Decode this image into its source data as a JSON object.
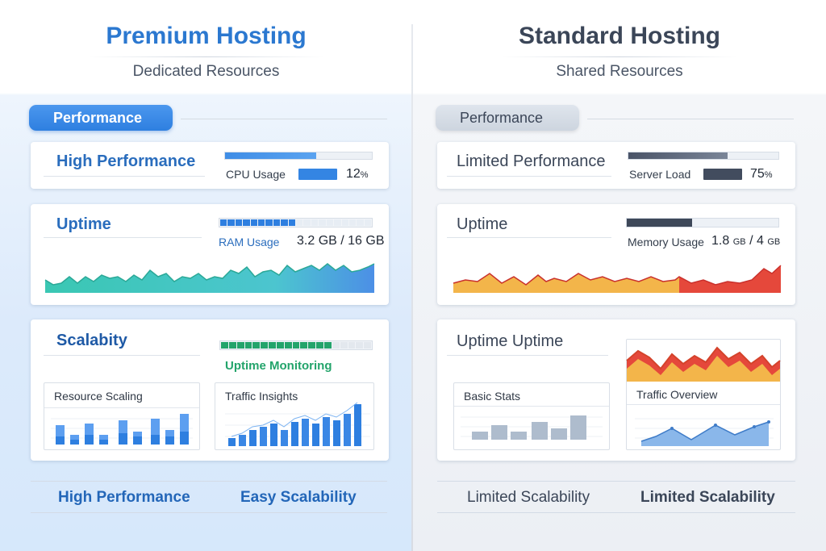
{
  "premium": {
    "title": "Premium Hosting",
    "subtitle": "Dedicated Resources",
    "pill_label": "Performance",
    "card1": {
      "title": "High Performance",
      "bar_fraction": 0.62,
      "metric_label": "CPU Usage",
      "metric_value": "12",
      "metric_unit": "%",
      "metric_fraction": 0.5
    },
    "card2": {
      "title": "Uptime",
      "segments_filled": 10,
      "segments_total": 20,
      "metric_label": "RAM Usage",
      "metric_value": "3.2 GB / 16 GB"
    },
    "card3": {
      "title": "Scalabity",
      "segments_filled": 14,
      "segments_total": 19,
      "status_label": "Uptime Monitoring",
      "panel_a": "Resource Scaling",
      "panel_b": "Traffic Insights"
    },
    "footer": [
      "High Performance",
      "Easy Scalability"
    ],
    "colors": {
      "accent": "#2e7fe0",
      "teal": "#3cc8b4",
      "green": "#23a46b"
    }
  },
  "standard": {
    "title": "Standard Hosting",
    "subtitle": "Shared Resources",
    "pill_label": "Performance",
    "card1": {
      "title": "Limited Performance",
      "bar_fraction": 0.66,
      "metric_label": "Server Load",
      "metric_value": "75",
      "metric_unit": "%",
      "metric_fraction": 0.9
    },
    "card2": {
      "title": "Uptime",
      "bar_fraction": 0.43,
      "metric_label": "Memory Usage",
      "metric_value_a": "1.8",
      "metric_unit_a": "GB",
      "metric_value_b": "/ 4",
      "metric_unit_b": "GB"
    },
    "card3": {
      "title": "Uptime Uptime",
      "panel_a": "Basic Stats",
      "panel_b": "Traffic Overview"
    },
    "footer": [
      "Limited Scalability",
      "Limited Scalability"
    ],
    "colors": {
      "dark": "#424c5e",
      "orange": "#f3b54a",
      "red": "#e5483b"
    }
  }
}
